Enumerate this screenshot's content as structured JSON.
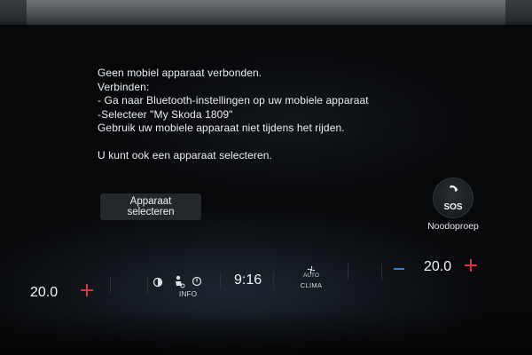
{
  "message": {
    "lines": [
      "Geen mobiel apparaat verbonden.",
      "Verbinden:",
      "- Ga naar Bluetooth-instellingen op uw mobiele apparaat",
      "-Selecteer \"My Skoda 1809\"",
      "Gebruik uw mobiele apparaat niet tijdens het rijden."
    ],
    "alt_line": "U kunt ook een apparaat selecteren."
  },
  "select_button": {
    "label": "Apparaat selecteren"
  },
  "emergency": {
    "badge": "SOS",
    "label": "Noodoproep"
  },
  "bottom_bar": {
    "temp_left": "20.0",
    "temp_right": "20.0",
    "info_label": "INFO",
    "clock": "9:16",
    "clima_auto": "AUTO",
    "clima_label": "CLIMA"
  },
  "colors": {
    "plus": "#e0303a",
    "minus": "#2f7fd9"
  }
}
